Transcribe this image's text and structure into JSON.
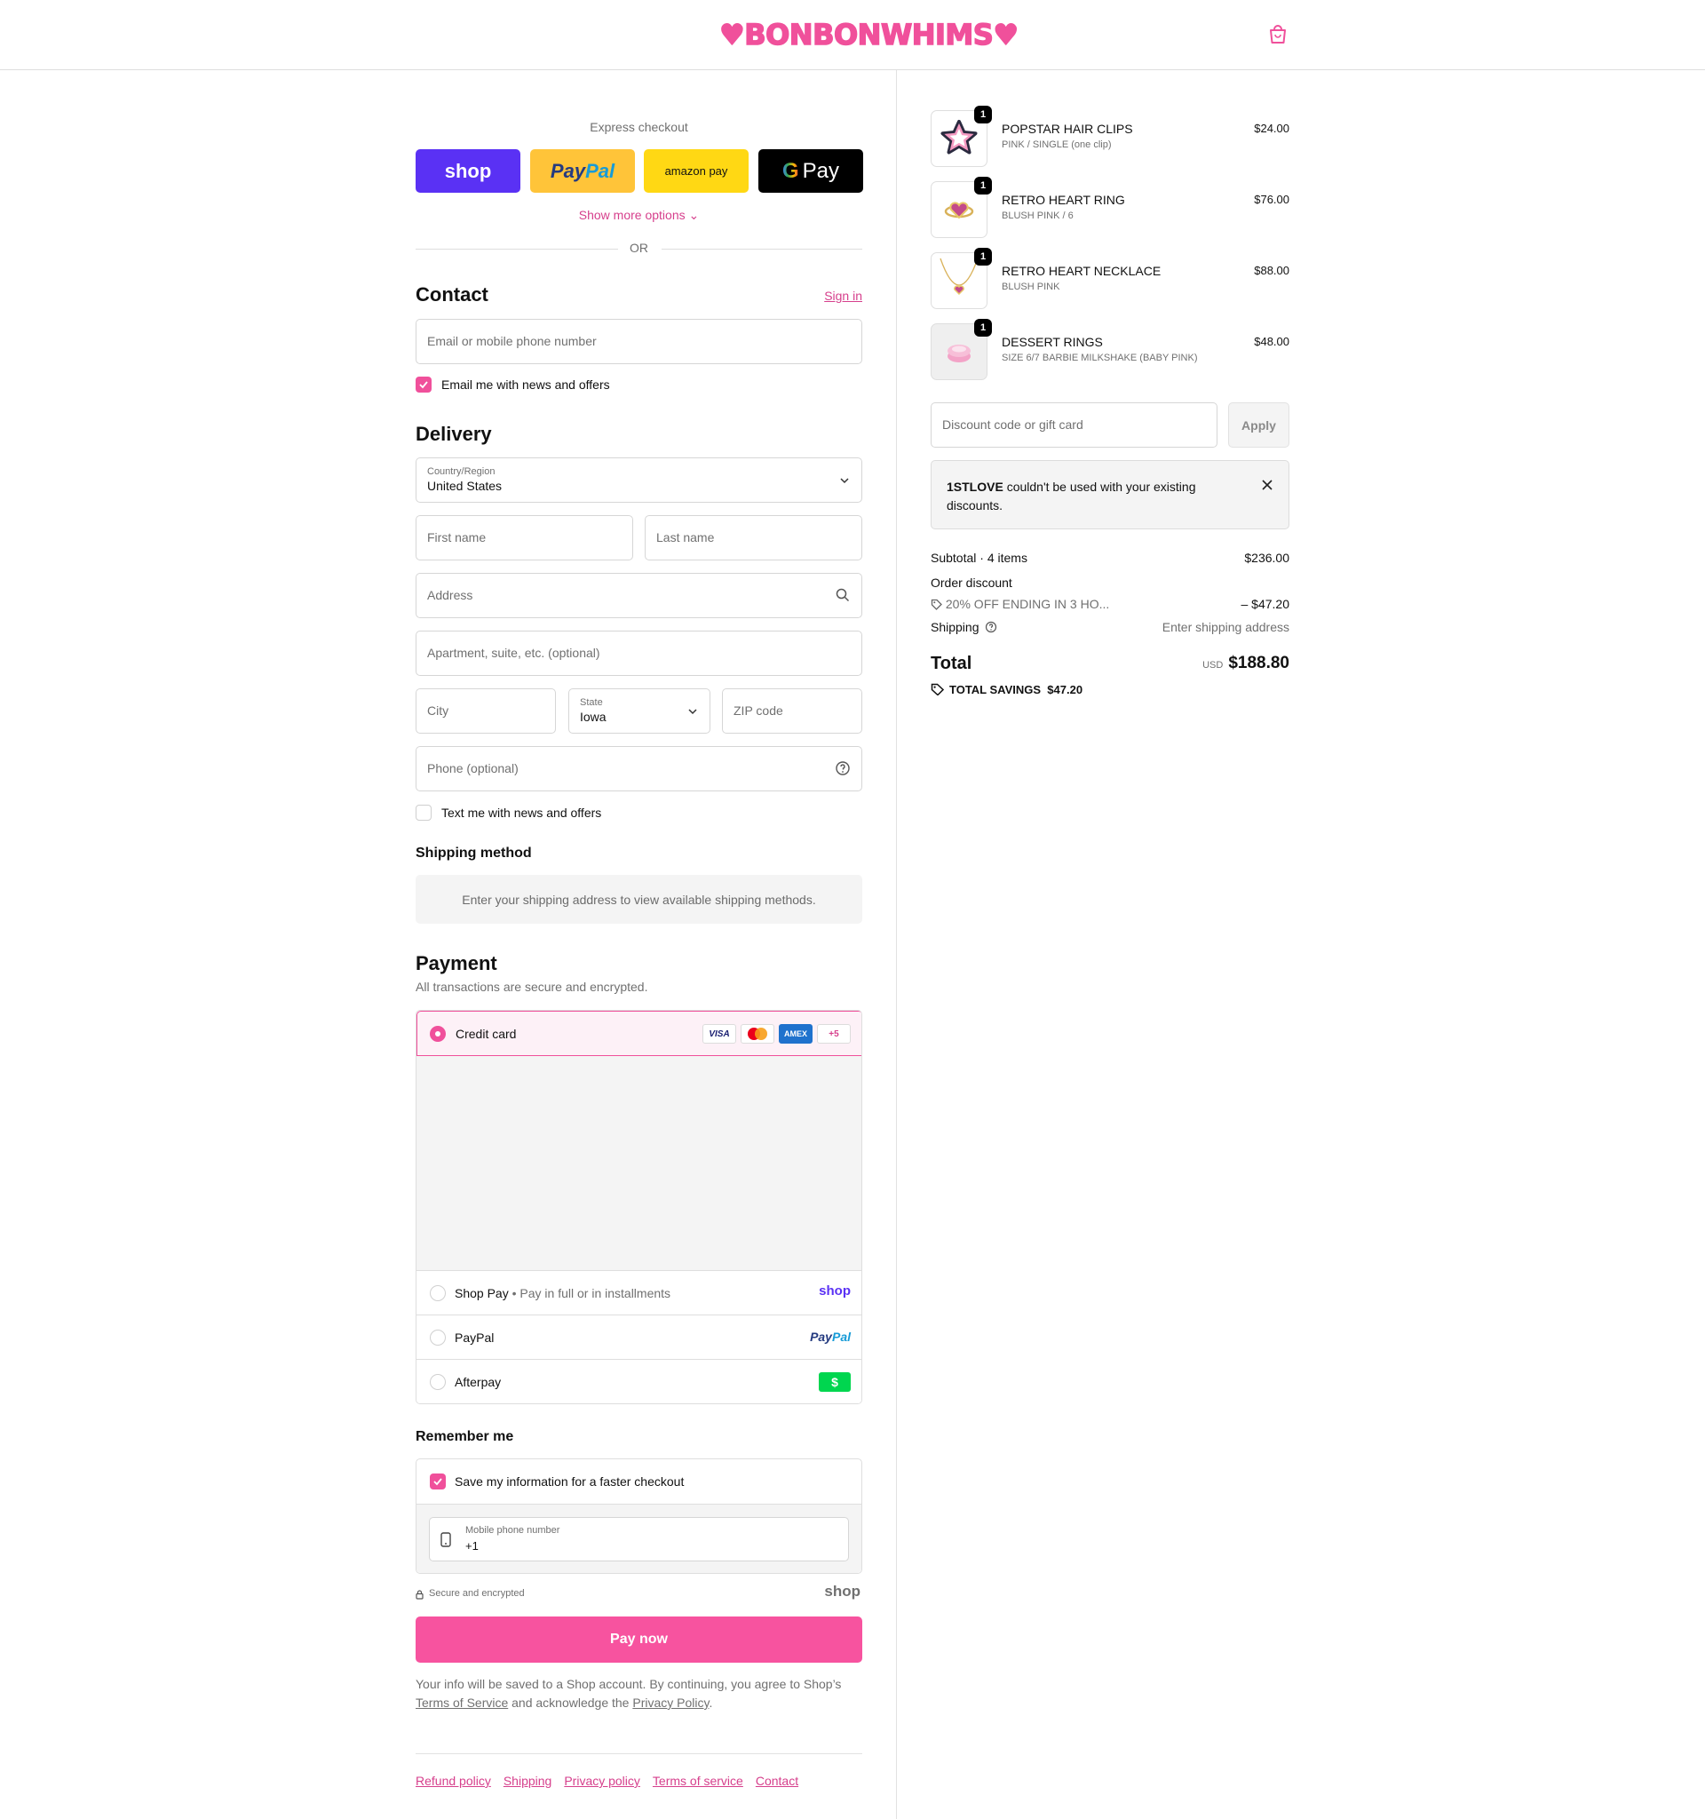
{
  "header": {
    "logo": "♥BONBONWHIMS♥",
    "brand_color": "#f0509b"
  },
  "express": {
    "title": "Express checkout",
    "shop_label": "shop",
    "paypal_label_1": "Pay",
    "paypal_label_2": "Pal",
    "amazon_label": "amazon pay",
    "gpay_g": "G",
    "gpay_label": "Pay",
    "show_more": "Show more options ⌄",
    "or": "OR"
  },
  "contact": {
    "title": "Contact",
    "sign_in": "Sign in",
    "email_placeholder": "Email or mobile phone number",
    "email_opt_in": "Email me with news and offers"
  },
  "delivery": {
    "title": "Delivery",
    "country_label": "Country/Region",
    "country_value": "United States",
    "first_name": "First name",
    "last_name": "Last name",
    "address": "Address",
    "apartment": "Apartment, suite, etc. (optional)",
    "city": "City",
    "state_label": "State",
    "state_value": "Iowa",
    "zip": "ZIP code",
    "phone": "Phone (optional)",
    "sms_opt_in": "Text me with news and offers"
  },
  "shipping_method": {
    "title": "Shipping method",
    "notice": "Enter your shipping address to view available shipping methods."
  },
  "payment": {
    "title": "Payment",
    "subtitle": "All transactions are secure and encrypted.",
    "credit_card": "Credit card",
    "card_visa": "VISA",
    "card_amex": "AMEX",
    "card_more": "+5",
    "shop_pay": "Shop Pay",
    "shop_pay_note": "Pay in full or in installments",
    "shop_pay_logo": "shop",
    "paypal": "PayPal",
    "paypal_logo_1": "Pay",
    "paypal_logo_2": "Pal",
    "afterpay": "Afterpay",
    "afterpay_logo": "$"
  },
  "remember": {
    "title": "Remember me",
    "save_info": "Save my information for a faster checkout",
    "mobile_label": "Mobile phone number",
    "mobile_value": "+1",
    "secure": "Secure and encrypted",
    "shop_logo": "shop"
  },
  "pay_now": "Pay now",
  "legal": {
    "text_1": "Your info will be saved to a Shop account. By continuing, you agree to Shop’s",
    "terms": "Terms of Service",
    "text_2": "and acknowledge the",
    "privacy": "Privacy Policy",
    "text_3": "."
  },
  "footer": [
    "Refund policy",
    "Shipping",
    "Privacy policy",
    "Terms of service",
    "Contact"
  ],
  "cart": {
    "items": [
      {
        "qty": "1",
        "name": "POPSTAR HAIR CLIPS",
        "variant": "PINK / SINGLE (one clip)",
        "price": "$24.00"
      },
      {
        "qty": "1",
        "name": "RETRO HEART RING",
        "variant": "BLUSH PINK / 6",
        "price": "$76.00"
      },
      {
        "qty": "1",
        "name": "RETRO HEART NECKLACE",
        "variant": "BLUSH PINK",
        "price": "$88.00"
      },
      {
        "qty": "1",
        "name": "DESSERT RINGS",
        "variant": "SIZE 6/7 BARBIE MILKSHAKE (BABY PINK)",
        "price": "$48.00"
      }
    ],
    "discount_placeholder": "Discount code or gift card",
    "apply": "Apply",
    "error_code": "1STLOVE",
    "error_text": "couldn't be used with your existing",
    "error_text_2": "discounts.",
    "subtotal_label": "Subtotal · 4 items",
    "subtotal_value": "$236.00",
    "order_discount_label": "Order discount",
    "discount_name": "20% OFF ENDING IN 3 HO...",
    "discount_value": "– $47.20",
    "shipping_label": "Shipping",
    "shipping_value": "Enter shipping address",
    "total_label": "Total",
    "currency": "USD",
    "total_value": "$188.80",
    "savings_label": "TOTAL SAVINGS",
    "savings_value": "$47.20"
  }
}
